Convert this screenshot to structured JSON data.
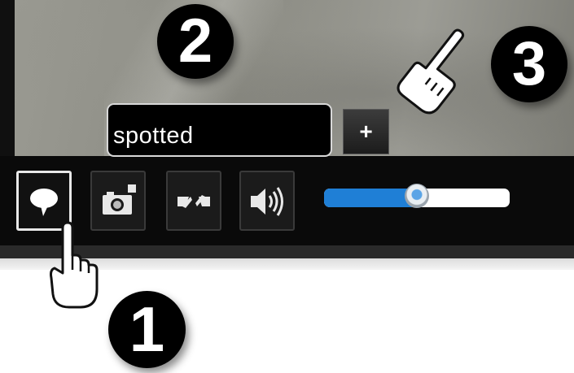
{
  "caption": {
    "value": "spotted"
  },
  "add_button": {
    "label": "+"
  },
  "controls": {
    "annotate": "speech-bubble-icon",
    "snapshot": "camera-icon",
    "fit": "shrink-arrows-icon",
    "volume": "speaker-icon"
  },
  "volume": {
    "level": 0.5
  },
  "steps": {
    "one": "1",
    "two": "2",
    "three": "3"
  },
  "colors": {
    "accent": "#1f7fd6",
    "bar": "#0a0a0a"
  }
}
